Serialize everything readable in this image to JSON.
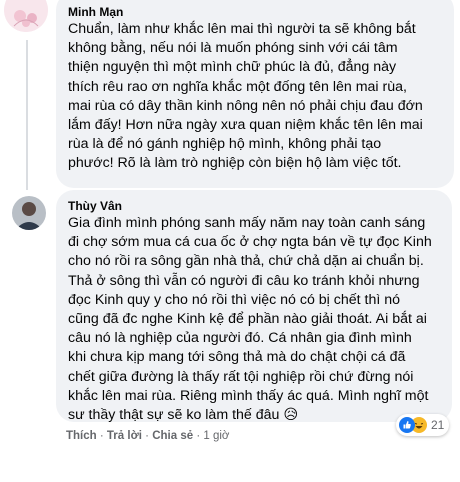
{
  "comment1": {
    "author": "Minh Mạn",
    "text": "Chuẩn, làm như khắc lên mai thì người ta sẽ không bắt\nkhông bằng, nếu nói là muốn phóng sinh với cái tâm\nthiện nguyện thì một mình chữ phúc là đủ, đẳng này\nthích rêu rao ơn nghĩa khắc một đống tên lên mai rùa,\nmai rùa có dây thần kinh nông nên nó phải chịu đau đớn\nlắm đấy! Hơn nữa ngày xưa quan niệm khắc tên lên mai\nrùa là để nó gánh nghiệp hộ mình, không phải tạo\nphước! Rõ là làm trò nghiệp còn biện hộ làm việc tốt."
  },
  "comment2": {
    "author": "Thùy Vân",
    "text": "Gia đình mình phóng sanh mấy năm nay toàn canh sáng\nđi chợ sớm mua cá cua ốc ở chợ ngta bán về tự đọc Kinh\ncho nó rồi ra sông gần nhà thả, chứ chả dặn ai chuẩn bị.\nThả ở sông thì vẫn có người đi câu ko tránh khỏi nhưng\nđọc Kinh quy y cho nó rồi thì việc nó có bị chết thì nó\ncũng đã đc nghe Kinh kệ để phần nào giải thoát. Ai bắt ai\ncâu nó là nghiệp của người đó. Cá nhân gia đình mình\nkhi chưa kịp mang tới sông thả mà do chật chội cá đã\nchết giữa đường là thấy rất tội nghiệp rồi chứ đừng nói\nkhắc lên mai rùa. Riêng mình thấy ác quá. Mình nghĩ một\nsư thầy thật sự sẽ ko làm thế đâu",
    "emoji": "😥",
    "reaction_count": "21",
    "actions": {
      "like": "Thích",
      "reply": "Trả lời",
      "share": "Chia sẻ",
      "time": "1 giờ",
      "sep": "·"
    }
  },
  "colors": {
    "bubble": "#f0f2f5",
    "text": "#050505",
    "secondary": "#65676b",
    "like_blue": "#1877f2",
    "haha_yellow": "#f7b928"
  }
}
